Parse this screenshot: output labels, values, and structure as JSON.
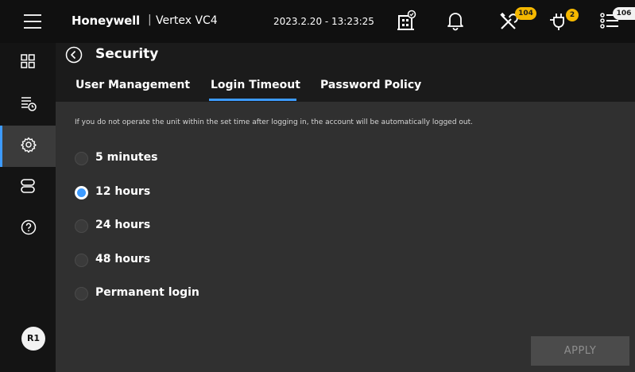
{
  "header": {
    "brand": "Honeywell",
    "separator": "|",
    "model": "Vertex VC4",
    "datetime": "2023.2.20 - 13:23:25",
    "badges": {
      "maintenance": "104",
      "alarms": "2",
      "events": "106"
    },
    "icons": [
      "menu-icon",
      "building-status-icon",
      "bell-icon",
      "tools-icon",
      "alarm-icon",
      "event-list-icon"
    ]
  },
  "sidebar": {
    "items": [
      {
        "name": "dashboard",
        "icon": "dashboard-grid-icon"
      },
      {
        "name": "schedule",
        "icon": "list-clock-icon"
      },
      {
        "name": "settings",
        "icon": "gear-icon",
        "active": true
      },
      {
        "name": "devices",
        "icon": "device-icon"
      },
      {
        "name": "help",
        "icon": "help-icon"
      }
    ],
    "user": "R1"
  },
  "page": {
    "title": "Security",
    "tabs": [
      {
        "label": "User Management"
      },
      {
        "label": "Login Timeout",
        "active": true
      },
      {
        "label": "Password Policy"
      }
    ]
  },
  "content": {
    "description": "If you do not operate the unit within the set time after logging in, the account will be automatically logged out.",
    "options": [
      {
        "label": "5 minutes",
        "checked": false
      },
      {
        "label": "12 hours",
        "checked": true
      },
      {
        "label": "24 hours",
        "checked": false
      },
      {
        "label": "48 hours",
        "checked": false
      },
      {
        "label": "Permanent login",
        "checked": false
      }
    ],
    "apply_label": "APPLY"
  },
  "colors": {
    "accent": "#3d9bff",
    "badge": "#f5b800",
    "background": "#1b1b1b",
    "panel": "#303030"
  }
}
